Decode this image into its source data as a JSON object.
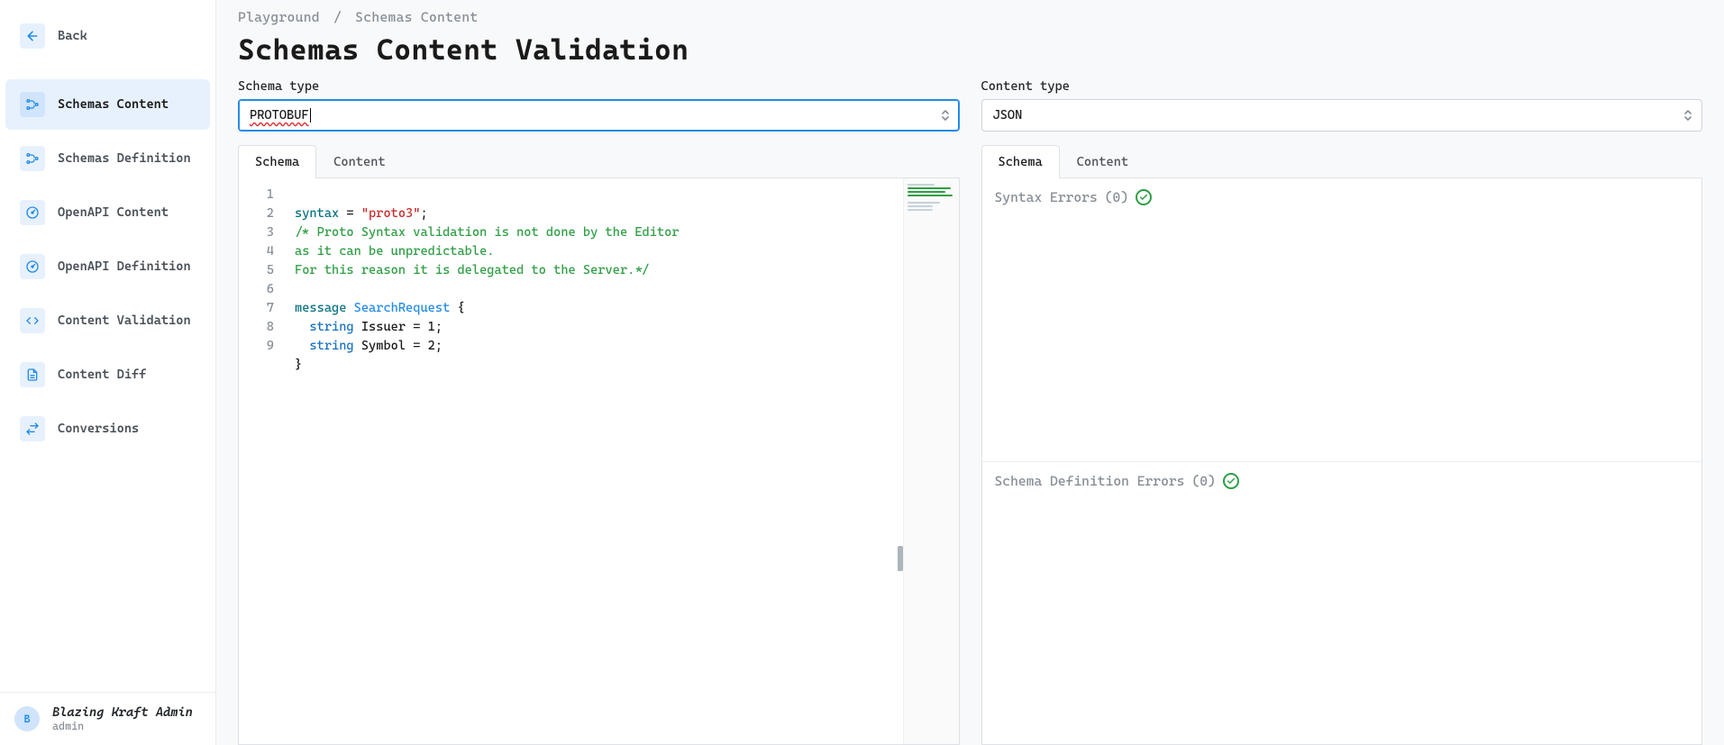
{
  "sidebar": {
    "back": "Back",
    "items": [
      {
        "label": "Schemas Content",
        "icon": "nodes-icon",
        "active": true
      },
      {
        "label": "Schemas Definition",
        "icon": "nodes-icon",
        "active": false
      },
      {
        "label": "OpenAPI Content",
        "icon": "gauge-icon",
        "active": false
      },
      {
        "label": "OpenAPI Definition",
        "icon": "gauge-icon",
        "active": false
      },
      {
        "label": "Content Validation",
        "icon": "code-icon",
        "active": false
      },
      {
        "label": "Content Diff",
        "icon": "file-icon",
        "active": false
      },
      {
        "label": "Conversions",
        "icon": "swap-icon",
        "active": false
      }
    ]
  },
  "user": {
    "initial": "B",
    "name": "Blazing Kraft Admin",
    "role": "admin"
  },
  "breadcrumb": {
    "root": "Playground",
    "sep": "/",
    "page": "Schemas Content"
  },
  "title": "Schemas Content Validation",
  "left": {
    "field_label": "Schema type",
    "select_value": "PROTOBUF",
    "tabs": {
      "schema": "Schema",
      "content": "Content"
    },
    "code": {
      "lines": [
        "1",
        "2",
        "3",
        "4",
        "5",
        "6",
        "7",
        "8",
        "9"
      ],
      "l1a": "syntax",
      "l1b": " = ",
      "l1c": "\"proto3\"",
      "l1d": ";",
      "l2": "/* Proto Syntax validation is not done by the Editor",
      "l3": "as it can be unpredictable.",
      "l4": "For this reason it is delegated to the Server.*/",
      "l5": "",
      "l6a": "message",
      "l6b": " SearchRequest",
      "l6c": " {",
      "l7a": "  string",
      "l7b": " Issuer = ",
      "l7c": "1",
      "l7d": ";",
      "l8a": "  string",
      "l8b": " Symbol = ",
      "l8c": "2",
      "l8d": ";",
      "l9": "}"
    }
  },
  "right": {
    "field_label": "Content type",
    "select_value": "JSON",
    "tabs": {
      "schema": "Schema",
      "content": "Content"
    },
    "errors": {
      "syntax_label": "Syntax Errors",
      "syntax_count": "(0)",
      "def_label": "Schema Definition Errors",
      "def_count": "(0)"
    }
  }
}
